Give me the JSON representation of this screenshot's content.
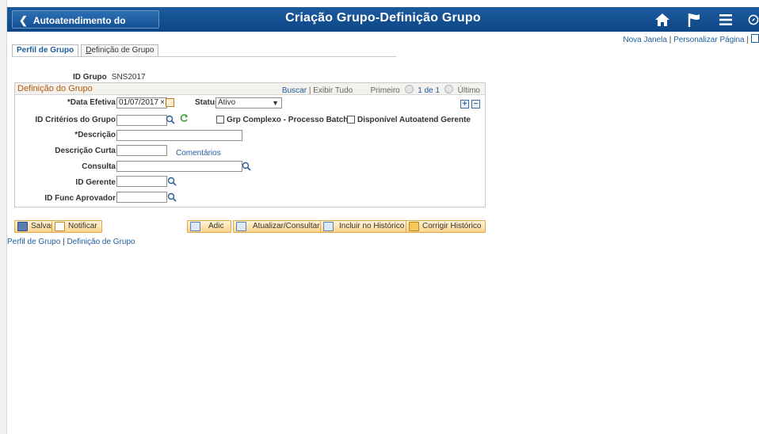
{
  "header": {
    "back_label": "Autoatendimento do Gerente",
    "title": "Criação Grupo-Definição Grupo",
    "icons": [
      "home-icon",
      "flag-icon",
      "menu-icon",
      "compass-icon"
    ]
  },
  "page_links": {
    "new_window": "Nova Janela",
    "separator": "|",
    "personalize": "Personalizar Página"
  },
  "tabs": [
    {
      "label": "Perfil de Grupo",
      "active": true
    },
    {
      "label_rest": "efinição de Grupo",
      "label_first": "D",
      "active": false
    }
  ],
  "group_id": {
    "label": "ID Grupo",
    "value": "SNS2017"
  },
  "section": {
    "title": "Definição do Grupo",
    "find": "Buscar",
    "sep": "|",
    "view_all": "Exibir Tudo",
    "first": "Primeiro",
    "count": "1 de 1",
    "last": "Último"
  },
  "form": {
    "effective_date": {
      "label": "*Data Efetiva",
      "value": "01/07/2017",
      "clear": "×"
    },
    "status": {
      "label": "Status",
      "value": "Ativo"
    },
    "criteria_id": {
      "label": "ID Critérios do Grupo",
      "value": ""
    },
    "batch_complex": {
      "label": "Grp Complexo - Processo Batch",
      "checked": false
    },
    "self_service": {
      "label": "Disponível Autoatend Gerente",
      "checked": false
    },
    "description": {
      "label": "*Descrição",
      "value": ""
    },
    "short_description": {
      "label": "Descrição Curta",
      "value": ""
    },
    "comments_link": "Comentários",
    "query": {
      "label": "Consulta",
      "value": ""
    },
    "manager_id": {
      "label": "ID Gerente",
      "value": ""
    },
    "approver_id": {
      "label": "ID Func Aprovador",
      "value": ""
    }
  },
  "toolbar": {
    "save": "Salvar",
    "notify": "Notificar",
    "add": "Adic",
    "update": "Atualizar/Consultar",
    "include_history": "Incluir no Histórico",
    "correct_history": "Corrigir Histórico"
  },
  "bottom_links": {
    "profile": "Perfil de Grupo",
    "sep": "|",
    "definition": "Definição de Grupo"
  },
  "colors": {
    "header_bg": "#0d4686",
    "section_title": "#b35a06",
    "link": "#1d5d9b",
    "button_bg": "#fcd58b"
  }
}
